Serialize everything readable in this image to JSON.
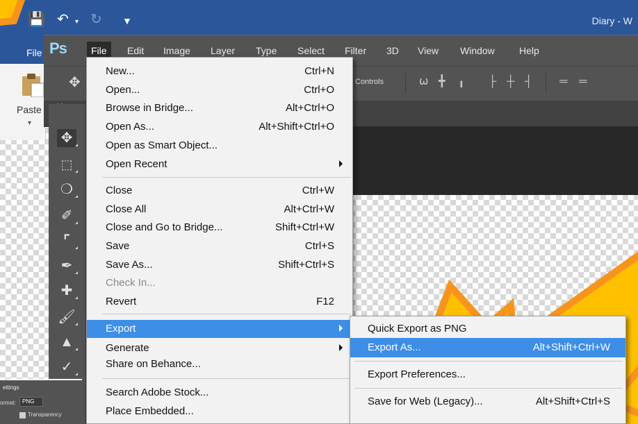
{
  "word": {
    "title": "Diary - W",
    "file_tab": "File",
    "paste_label": "Paste"
  },
  "photoshop": {
    "logo": "Ps",
    "menus": [
      "File",
      "Edit",
      "Image",
      "Layer",
      "Type",
      "Select",
      "Filter",
      "3D",
      "View",
      "Window",
      "Help"
    ],
    "controls_label": "Controls"
  },
  "file_menu": {
    "items": [
      {
        "label": "New...",
        "shortcut": "Ctrl+N"
      },
      {
        "label": "Open...",
        "shortcut": "Ctrl+O"
      },
      {
        "label": "Browse in Bridge...",
        "shortcut": "Alt+Ctrl+O"
      },
      {
        "label": "Open As...",
        "shortcut": "Alt+Shift+Ctrl+O"
      },
      {
        "label": "Open as Smart Object..."
      },
      {
        "label": "Open Recent"
      },
      {
        "label": "Close",
        "shortcut": "Ctrl+W"
      },
      {
        "label": "Close All",
        "shortcut": "Alt+Ctrl+W"
      },
      {
        "label": "Close and Go to Bridge...",
        "shortcut": "Shift+Ctrl+W"
      },
      {
        "label": "Save",
        "shortcut": "Ctrl+S"
      },
      {
        "label": "Save As...",
        "shortcut": "Shift+Ctrl+S"
      },
      {
        "label": "Check In..."
      },
      {
        "label": "Revert",
        "shortcut": "F12"
      },
      {
        "label": "Export"
      },
      {
        "label": "Generate"
      },
      {
        "label": "Share on Behance..."
      },
      {
        "label": "Search Adobe Stock..."
      },
      {
        "label": "Place Embedded..."
      }
    ]
  },
  "export_submenu": {
    "items": [
      {
        "label": "Quick Export as PNG"
      },
      {
        "label": "Export As...",
        "shortcut": "Alt+Shift+Ctrl+W"
      },
      {
        "label": "Export Preferences..."
      },
      {
        "label": "Save for Web (Legacy)...",
        "shortcut": "Alt+Shift+Ctrl+S"
      }
    ]
  },
  "export_panel": {
    "settings": "ettings",
    "format_label": "ormat:",
    "format_value": "PNG",
    "transparency": "Transparency"
  },
  "colors": {
    "word_blue": "#2b579a",
    "ps_gray": "#535353",
    "menu_bg": "#f2f2f2",
    "highlight": "#3d8ee7",
    "star_fill": "#ffc000",
    "star_stroke": "#f7941d"
  }
}
